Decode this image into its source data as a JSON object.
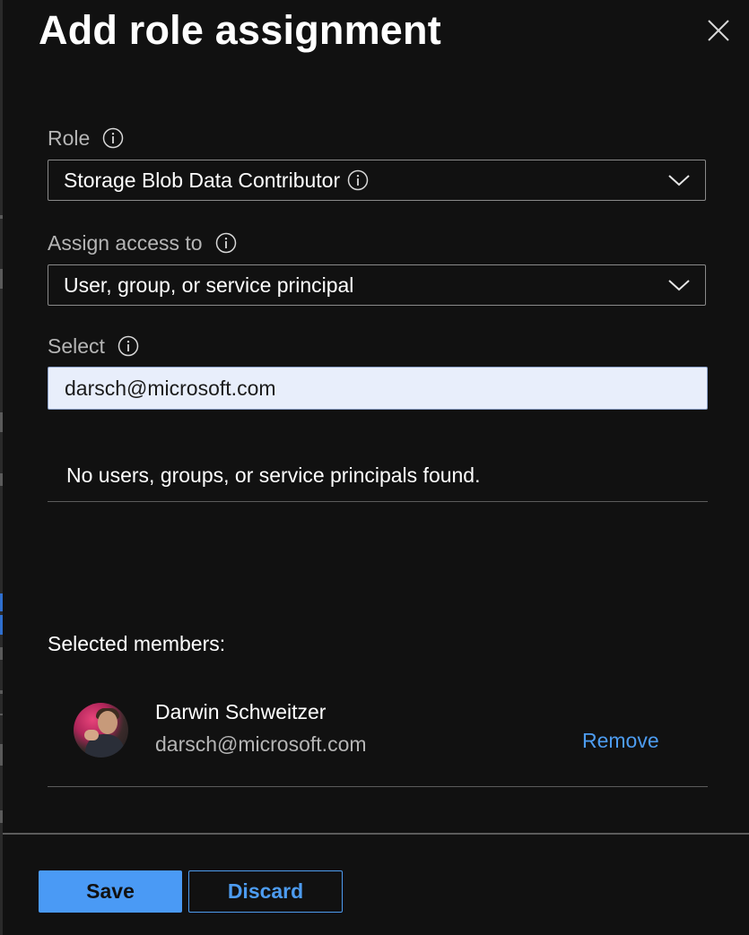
{
  "panel": {
    "title": "Add role assignment",
    "close_icon": "close-icon"
  },
  "role": {
    "label": "Role",
    "value": "Storage Blob Data Contributor",
    "info_icon": "info-icon",
    "chevron_icon": "chevron-down-icon"
  },
  "assign_access": {
    "label": "Assign access to",
    "value": "User, group, or service principal",
    "info_icon": "info-icon",
    "chevron_icon": "chevron-down-icon"
  },
  "select": {
    "label": "Select",
    "value": "darsch@microsoft.com",
    "info_icon": "info-icon"
  },
  "search_results": {
    "empty_message": "No users, groups, or service principals found."
  },
  "selected_members": {
    "heading": "Selected members:",
    "items": [
      {
        "name": "Darwin Schweitzer",
        "email": "darsch@microsoft.com",
        "remove_label": "Remove"
      }
    ]
  },
  "footer": {
    "save_label": "Save",
    "discard_label": "Discard"
  },
  "colors": {
    "background": "#111111",
    "accent": "#4a9af5",
    "link": "#4d9cf0",
    "input_bg": "#e8eefb"
  }
}
